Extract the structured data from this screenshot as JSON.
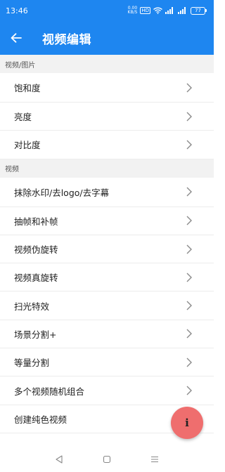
{
  "status_bar": {
    "time": "13:46",
    "network_speed_top": "0.00",
    "network_speed_bottom": "KB/S",
    "hd_badge": "HD",
    "battery_level": "77"
  },
  "app_bar": {
    "title": "视频编辑",
    "back_icon": "arrow-left-icon"
  },
  "sections": [
    {
      "header": "视频/图片",
      "items": [
        "饱和度",
        "亮度",
        "对比度"
      ]
    },
    {
      "header": "视频",
      "items": [
        "抹除水印/去logo/去字幕",
        "抽帧和补帧",
        "视频伪旋转",
        "视频真旋转",
        "扫光特效",
        "场景分割+",
        "等量分割",
        "多个视频随机组合",
        "创建纯色视频"
      ]
    }
  ],
  "fab": {
    "label": "i",
    "color": "#ef6e6e"
  },
  "colors": {
    "primary": "#1e86f0",
    "section_bg": "#f2f2f2"
  }
}
